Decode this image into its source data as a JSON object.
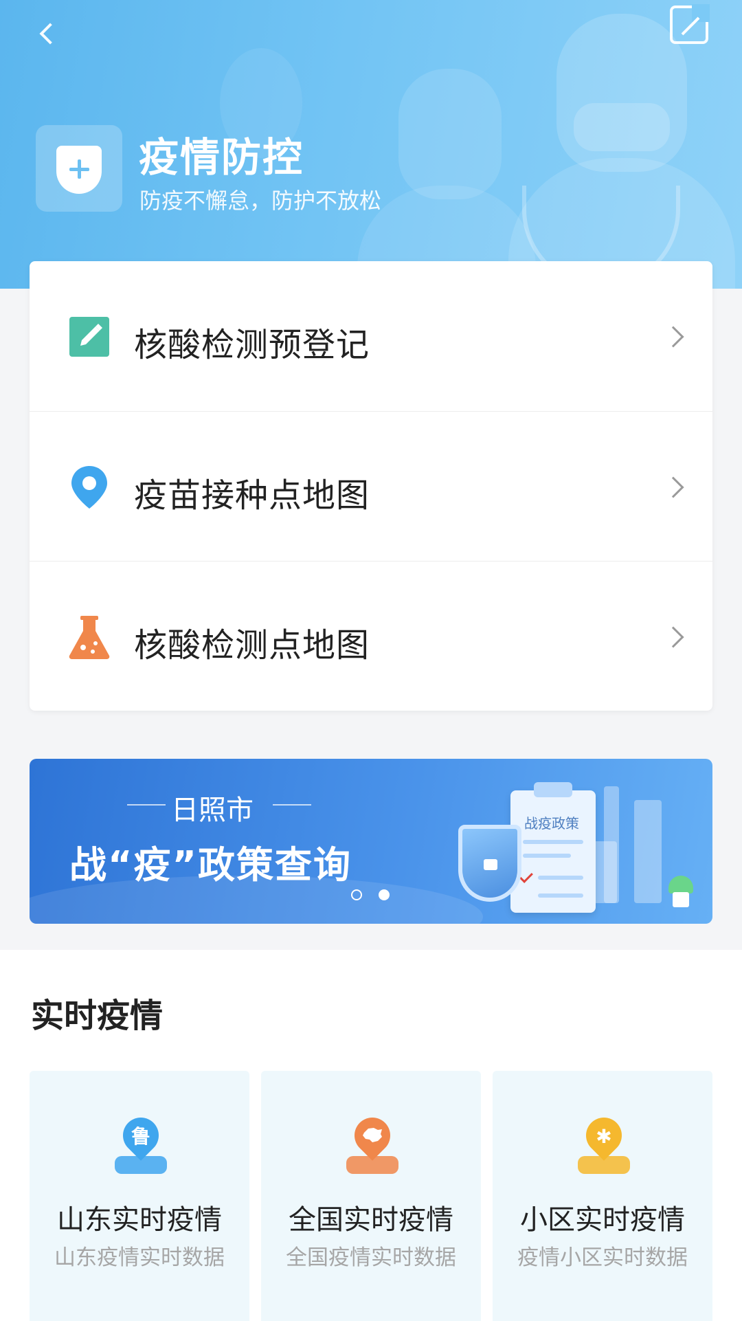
{
  "header": {
    "title": "疫情防控",
    "subtitle": "防疫不懈怠，防护不放松"
  },
  "menu": [
    {
      "label": "核酸检测预登记",
      "icon": "edit-icon",
      "color": "#4dbfa6"
    },
    {
      "label": "疫苗接种点地图",
      "icon": "map-pin-icon",
      "color": "#3fa6ee"
    },
    {
      "label": "核酸检测点地图",
      "icon": "flask-icon",
      "color": "#f0874b"
    }
  ],
  "banner": {
    "city": "日照市",
    "title": "战“疫”政策查询",
    "clipboard_title": "战疫政策",
    "page_count": 2,
    "active_page": 2
  },
  "realtime": {
    "title": "实时疫情",
    "tiles": [
      {
        "title": "山东实时疫情",
        "subtitle": "山东疫情实时数据",
        "icon": "shandong-pin-icon",
        "glyph": "鲁",
        "color": "#3fa6ee"
      },
      {
        "title": "全国实时疫情",
        "subtitle": "全国疫情实时数据",
        "icon": "china-map-pin-icon",
        "glyph": "",
        "color": "#f0874b"
      },
      {
        "title": "小区实时疫情",
        "subtitle": "疫情小区实时数据",
        "icon": "virus-pin-icon",
        "glyph": "✱",
        "color": "#f5b82e"
      }
    ]
  },
  "colors": {
    "header_gradient_start": "#5bb6ee",
    "banner_gradient_start": "#2e74d6",
    "tile_background": "#eef8fc"
  }
}
